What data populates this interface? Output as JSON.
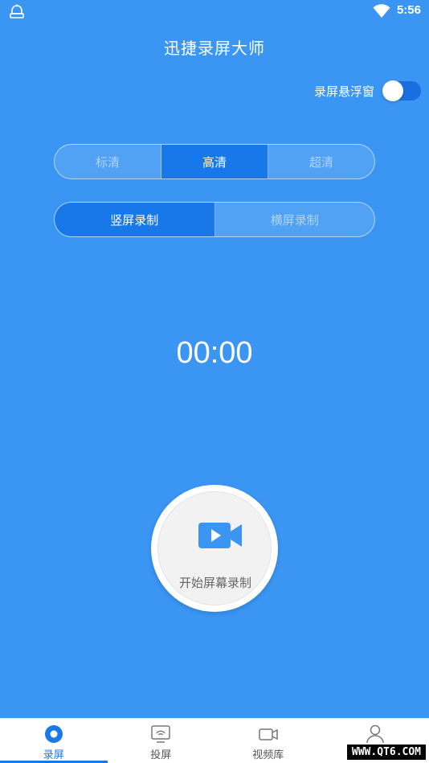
{
  "status": {
    "time": "5:56"
  },
  "app": {
    "title": "迅捷录屏大师"
  },
  "float_window": {
    "label": "录屏悬浮窗",
    "enabled": true
  },
  "quality": {
    "options": [
      "标清",
      "高清",
      "超清"
    ],
    "selected": "高清"
  },
  "orientation": {
    "options": [
      "竖屏录制",
      "横屏录制"
    ],
    "selected": "竖屏录制"
  },
  "timer": "00:00",
  "record_button": {
    "label": "开始屏幕录制"
  },
  "nav": {
    "items": [
      {
        "label": "录屏",
        "icon": "record-dot-icon"
      },
      {
        "label": "投屏",
        "icon": "cast-screen-icon"
      },
      {
        "label": "视频库",
        "icon": "video-camera-icon"
      },
      {
        "label": "",
        "icon": "user-icon"
      }
    ],
    "active": "录屏"
  },
  "watermark": "WWW.QT6.COM",
  "colors": {
    "background": "#3a95f3",
    "accent": "#1878ea",
    "toggle": "#1a6fe0"
  }
}
